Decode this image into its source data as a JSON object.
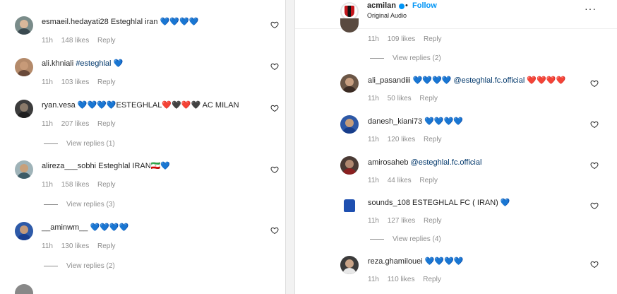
{
  "left": {
    "comments": [
      {
        "username": "esmaeil.hedayati28",
        "text": "Esteghlal iran",
        "emoji": "💙💙💙💙",
        "time": "11h",
        "likes": "148 likes",
        "reply": "Reply",
        "replies": ""
      },
      {
        "username": "ali.khniali",
        "text": "#esteghlal",
        "emoji": "💙",
        "time": "11h",
        "likes": "103 likes",
        "reply": "Reply",
        "replies": ""
      },
      {
        "username": "ryan.vesa",
        "text_pre": "💙💙💙💙ESTEGHLAL❤️🖤❤️🖤",
        "text_post": "AC MILAN",
        "time": "11h",
        "likes": "207 likes",
        "reply": "Reply",
        "replies": "View replies (1)"
      },
      {
        "username": "alireza___sobhi",
        "text": "Esteghlal IRAN",
        "emoji": "🇮🇷💙",
        "time": "11h",
        "likes": "158 likes",
        "reply": "Reply",
        "replies": "View replies (3)"
      },
      {
        "username": "__aminwm__",
        "text": "",
        "emoji": "💙💙💙💙",
        "time": "11h",
        "likes": "130 likes",
        "reply": "Reply",
        "replies": "View replies (2)"
      }
    ]
  },
  "right": {
    "header": {
      "account": "acmilan",
      "separator": "•",
      "follow": "Follow",
      "audio": "Original Audio",
      "more": "···"
    },
    "top_meta": {
      "time": "11h",
      "likes": "109 likes",
      "reply": "Reply",
      "replies": "View replies (2)"
    },
    "comments": [
      {
        "username": "ali_pasandiii",
        "emoji_pre": "💙💙💙💙",
        "mention": "@esteghlal.fc.official",
        "emoji_post": "❤️❤️❤️❤️",
        "time": "11h",
        "likes": "50 likes",
        "reply": "Reply",
        "replies": ""
      },
      {
        "username": "danesh_kiani73",
        "emoji_pre": "💙💙💙💙",
        "mention": "",
        "emoji_post": "",
        "time": "11h",
        "likes": "120 likes",
        "reply": "Reply",
        "replies": ""
      },
      {
        "username": "amirosaheb",
        "emoji_pre": "",
        "mention": "@esteghlal.fc.official",
        "emoji_post": "",
        "time": "11h",
        "likes": "44 likes",
        "reply": "Reply",
        "replies": ""
      },
      {
        "username": "sounds_108",
        "text": "ESTEGHLAL FC ( IRAN)",
        "emoji_post": "💙",
        "time": "11h",
        "likes": "127 likes",
        "reply": "Reply",
        "replies": "View replies (4)"
      },
      {
        "username": "reza.ghamilouei",
        "emoji_pre": "💙💙💙💙",
        "time": "11h",
        "likes": "110 likes",
        "reply": "Reply",
        "replies": ""
      }
    ]
  },
  "colors": {
    "link": "#00376b",
    "follow": "#0095f6",
    "meta": "#8e8e8e",
    "text": "#262626"
  }
}
